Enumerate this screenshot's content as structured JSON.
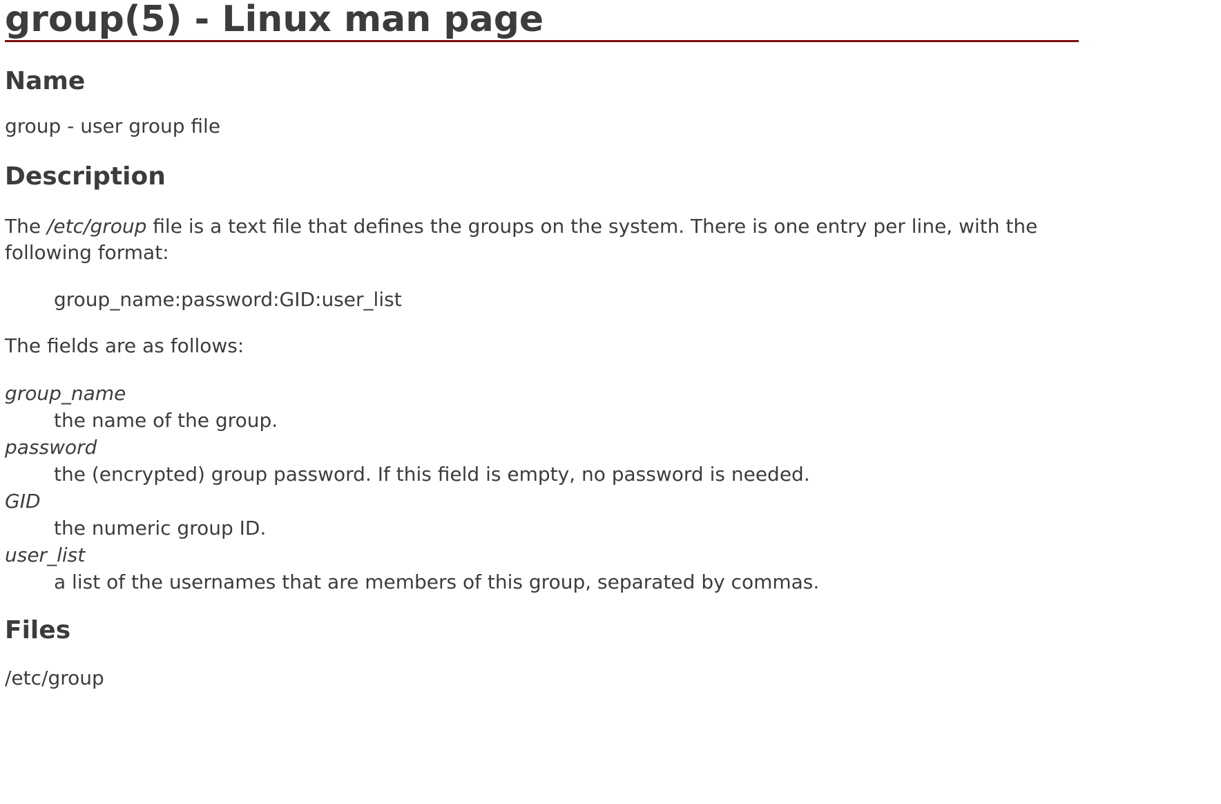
{
  "page": {
    "title": "group(5) - Linux man page"
  },
  "sections": {
    "name": {
      "heading": "Name",
      "text": "group - user group file"
    },
    "description": {
      "heading": "Description",
      "intro_before": "The ",
      "intro_path": "/etc/group",
      "intro_after": " file is a text file that defines the groups on the system. There is one entry per line, with the following format:",
      "format": "group_name:password:GID:user_list",
      "fields_intro": "The fields are as follows:",
      "fields": [
        {
          "term": "group_name",
          "definition": "the name of the group."
        },
        {
          "term": "password",
          "definition": "the (encrypted) group password. If this field is empty, no password is needed."
        },
        {
          "term": "GID",
          "definition": "the numeric group ID."
        },
        {
          "term": "user_list",
          "definition": "a list of the usernames that are members of this group, separated by commas."
        }
      ]
    },
    "files": {
      "heading": "Files",
      "text": "/etc/group"
    }
  }
}
